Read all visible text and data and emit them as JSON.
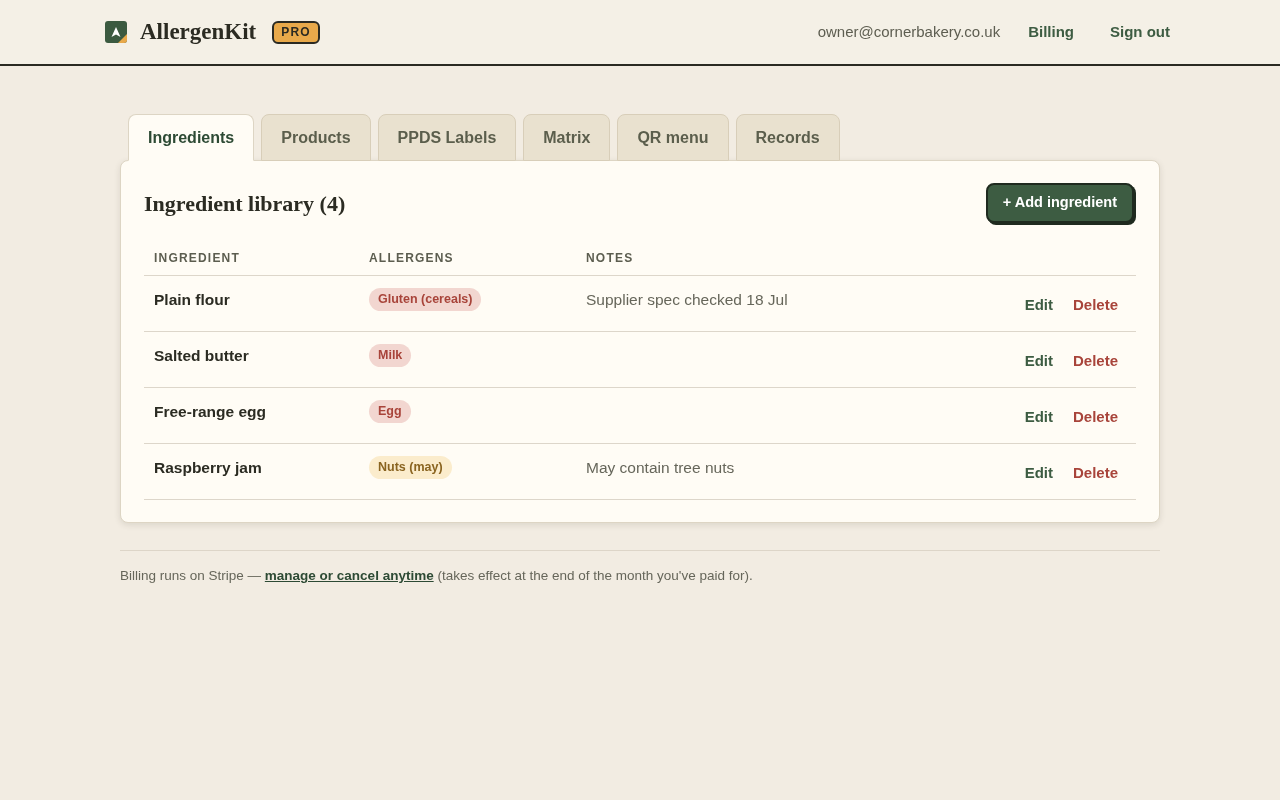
{
  "header": {
    "brand": "AllergenKit",
    "plan_badge": "PRO",
    "account_email": "owner@cornerbakery.co.uk",
    "links": [
      "Billing",
      "Sign out"
    ]
  },
  "tabs": [
    {
      "label": "Ingredients",
      "selected": true
    },
    {
      "label": "Products",
      "selected": false
    },
    {
      "label": "PPDS Labels",
      "selected": false
    },
    {
      "label": "Matrix",
      "selected": false
    },
    {
      "label": "QR menu",
      "selected": false
    },
    {
      "label": "Records",
      "selected": false
    }
  ],
  "library": {
    "title": "Ingredient library (4)",
    "add_button": "+ Add ingredient",
    "columns": [
      "INGREDIENT",
      "ALLERGENS",
      "NOTES"
    ],
    "rows": [
      {
        "name": "Plain flour",
        "allergens": [
          {
            "label": "Gluten (cereals)",
            "kind": "contains"
          }
        ],
        "notes": "Supplier spec checked 18 Jul",
        "actions": [
          {
            "label": "Edit",
            "kind": "edit"
          },
          {
            "label": "Delete",
            "kind": "delete"
          }
        ]
      },
      {
        "name": "Salted butter",
        "allergens": [
          {
            "label": "Milk",
            "kind": "contains"
          }
        ],
        "actions": [
          {
            "label": "Edit",
            "kind": "edit"
          },
          {
            "label": "Delete",
            "kind": "delete"
          }
        ]
      },
      {
        "name": "Free-range egg",
        "allergens": [
          {
            "label": "Egg",
            "kind": "contains"
          }
        ],
        "actions": [
          {
            "label": "Edit",
            "kind": "edit"
          },
          {
            "label": "Delete",
            "kind": "delete"
          }
        ]
      },
      {
        "name": "Raspberry jam",
        "allergens": [
          {
            "label": "Nuts (may)",
            "kind": "may_contain"
          }
        ],
        "notes": "May contain tree nuts",
        "actions": [
          {
            "label": "Edit",
            "kind": "edit"
          },
          {
            "label": "Delete",
            "kind": "delete"
          }
        ]
      }
    ]
  },
  "footer": {
    "text_before": "Billing runs on Stripe — ",
    "link": "manage or cancel anytime",
    "text_after": " (takes effect at the end of the month you've paid for)."
  }
}
